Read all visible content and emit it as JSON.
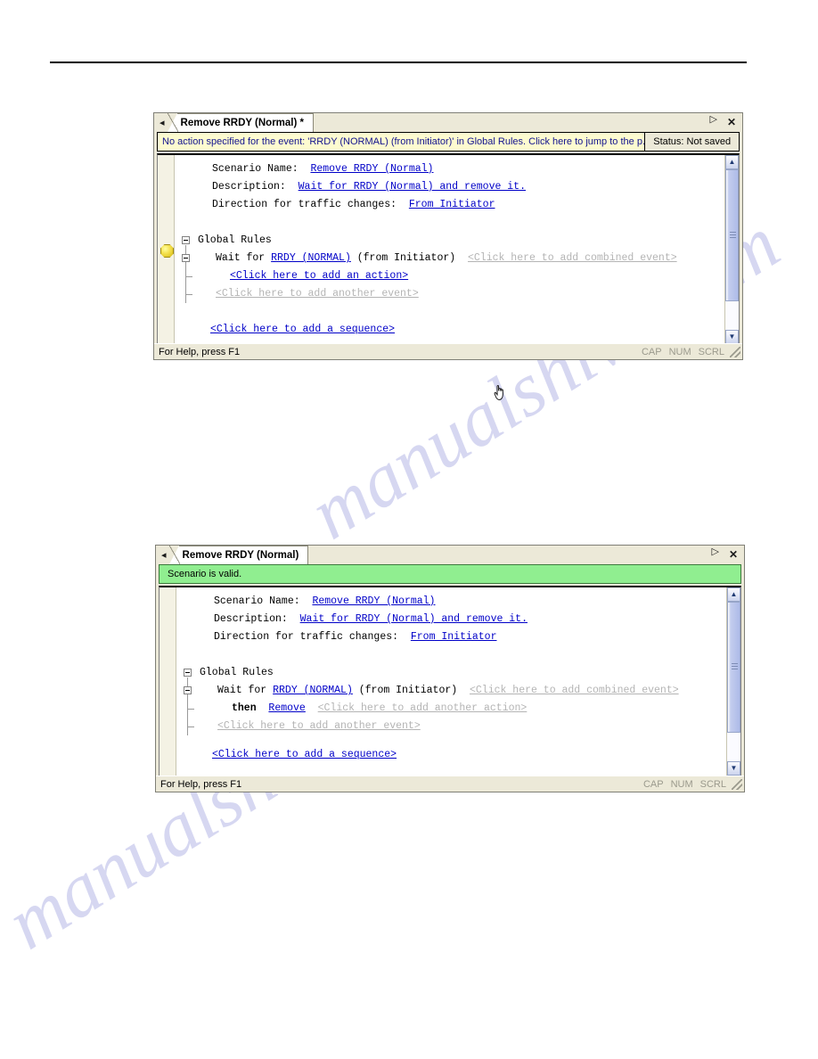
{
  "page": {
    "watermark_text": "manualshive.com"
  },
  "windows": [
    {
      "id": "top",
      "tab": {
        "nav_left_icon": "nav-left-arrow-icon",
        "title": "Remove RRDY (Normal) *",
        "nav_right_icon": "nav-right-arrow-icon",
        "close_icon": "close-icon"
      },
      "message_bar": {
        "type": "warning",
        "text": "No action specified for the event: 'RRDY (NORMAL) (from Initiator)' in Global Rules.  Click here to jump to the p...",
        "status_label": "Status: Not saved"
      },
      "gutter": {
        "marker_icon": "warning-marker-icon",
        "marker_visible": true
      },
      "editor": {
        "fields": [
          {
            "label": "Scenario Name:",
            "value": "Remove RRDY (Normal)"
          },
          {
            "label": "Description:",
            "value": "Wait for RRDY (Normal) and remove it."
          },
          {
            "label": "Direction for traffic changes:",
            "value": "From Initiator"
          }
        ],
        "tree": {
          "root_label": "Global Rules",
          "event_prefix": "Wait for ",
          "event_name": "RRDY (NORMAL)",
          "event_suffix": " (from Initiator)",
          "add_combined_event": "<Click here to add combined event>",
          "action_line": "<Click here to add an action>",
          "add_another_event": "<Click here to add another event>"
        },
        "add_sequence": "<Click here to add a sequence>"
      },
      "status_bar": {
        "help_text": "For Help, press F1",
        "indicators": [
          "CAP",
          "NUM",
          "SCRL"
        ]
      }
    },
    {
      "id": "bottom",
      "tab": {
        "nav_left_icon": "nav-left-arrow-icon",
        "title": "Remove RRDY (Normal)",
        "nav_right_icon": "nav-right-arrow-icon",
        "close_icon": "close-icon"
      },
      "message_bar": {
        "type": "valid",
        "text": "Scenario is valid."
      },
      "gutter": {
        "marker_icon": "warning-marker-icon",
        "marker_visible": false
      },
      "editor": {
        "fields": [
          {
            "label": "Scenario Name:",
            "value": "Remove RRDY (Normal)"
          },
          {
            "label": "Description:",
            "value": "Wait for RRDY (Normal) and remove it."
          },
          {
            "label": "Direction for traffic changes:",
            "value": "From Initiator"
          }
        ],
        "tree": {
          "root_label": "Global Rules",
          "event_prefix": "Wait for ",
          "event_name": "RRDY (NORMAL)",
          "event_suffix": " (from Initiator)",
          "add_combined_event": "<Click here to add combined event>",
          "action_keyword": "then",
          "action_value": "Remove",
          "action_line": "<Click here to add another action>",
          "add_another_event": "<Click here to add another event>"
        },
        "add_sequence": "<Click here to add a sequence>"
      },
      "status_bar": {
        "help_text": "For Help, press F1",
        "indicators": [
          "CAP",
          "NUM",
          "SCRL"
        ]
      }
    }
  ],
  "colors": {
    "warning_bar": "#fdfbd0",
    "valid_bar": "#90ee90",
    "link": "#0000c8",
    "dim_link": "#b4b4b4",
    "window_chrome": "#ece9d8",
    "marker": "#f4e04d"
  }
}
